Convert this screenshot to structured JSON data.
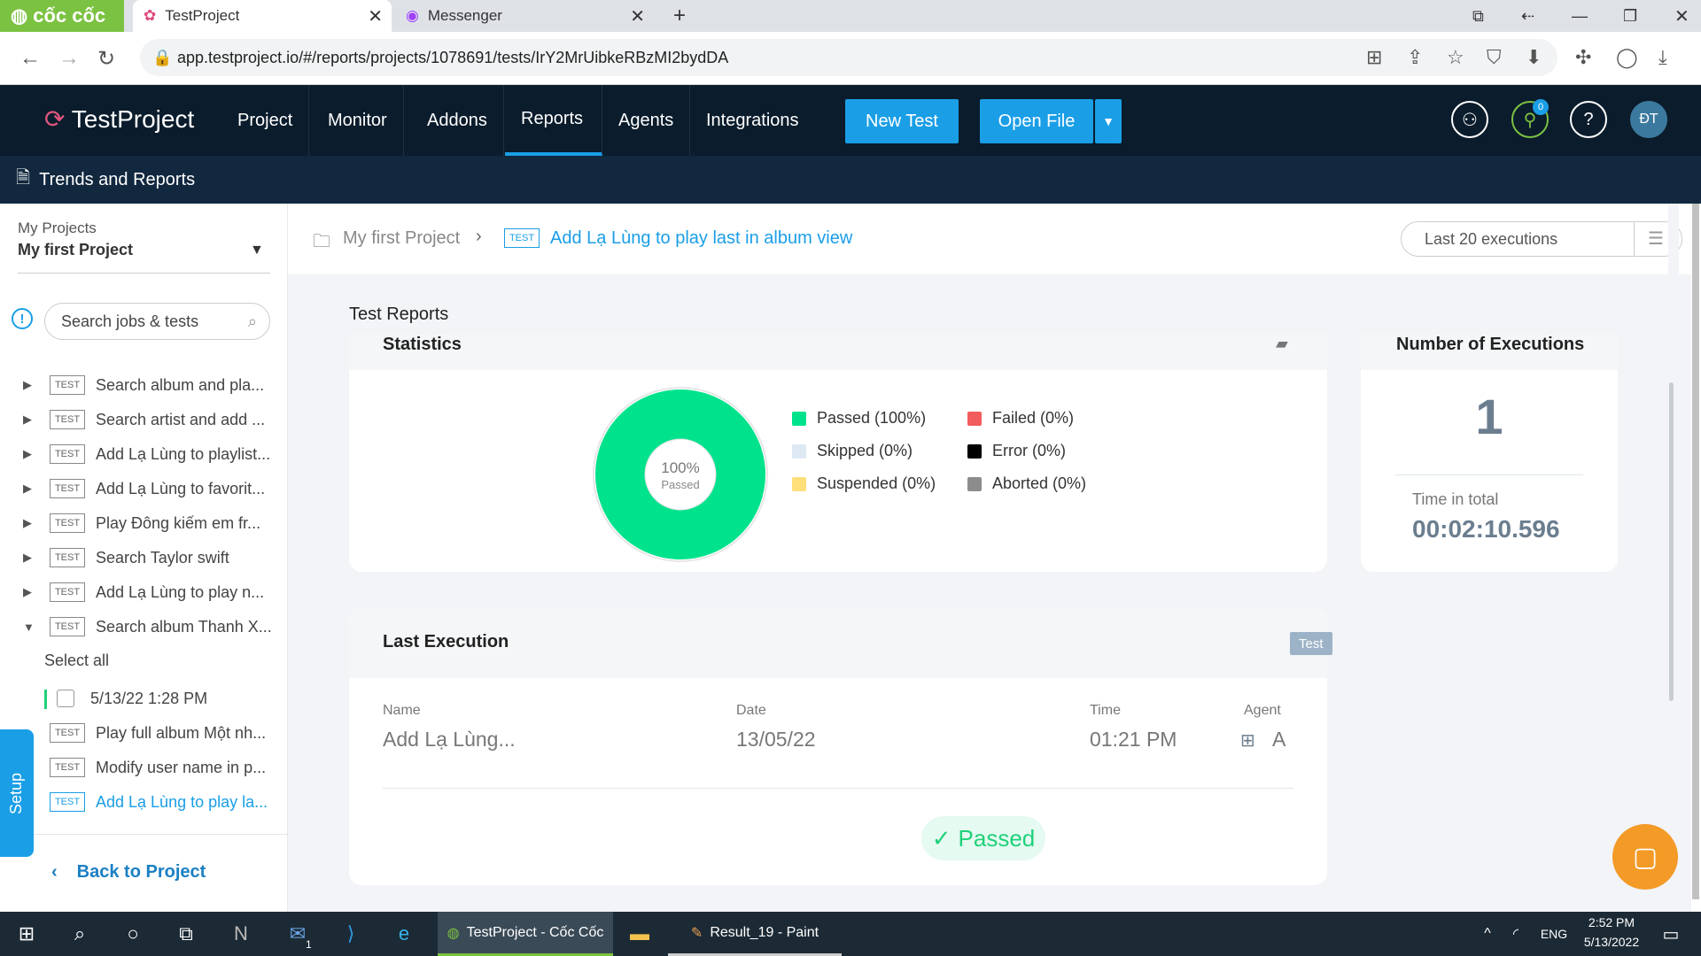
{
  "browser": {
    "brand": "cốc cốc",
    "tabs": [
      {
        "title": "TestProject"
      },
      {
        "title": "Messenger"
      }
    ],
    "url": "app.testproject.io/#/reports/projects/1078691/tests/IrY2MrUibkeRBzMI2bydDA"
  },
  "app": {
    "logo": "TestProject",
    "nav": [
      "Project",
      "Monitor",
      "Addons",
      "Reports",
      "Agents",
      "Integrations"
    ],
    "selected_nav": "Reports",
    "new_test": "New Test",
    "open_file": "Open File",
    "avatar": "ĐT",
    "notification_count": "0",
    "subheader": "Trends and Reports"
  },
  "sidebar": {
    "projects_label": "My Projects",
    "project_name": "My first Project",
    "search_placeholder": "Search jobs & tests",
    "items": [
      {
        "badge": "TEST",
        "label": "Search album and pla..."
      },
      {
        "badge": "TEST",
        "label": "Search artist and add ..."
      },
      {
        "badge": "TEST",
        "label": "Add Lạ Lùng to playlist..."
      },
      {
        "badge": "TEST",
        "label": "Add Lạ Lùng to favorit..."
      },
      {
        "badge": "TEST",
        "label": "Play Đông kiếm em fr..."
      },
      {
        "badge": "TEST",
        "label": "Search Taylor swift"
      },
      {
        "badge": "TEST",
        "label": "Add Lạ Lùng to play n..."
      },
      {
        "badge": "TEST",
        "label": "Search album Thanh X..."
      }
    ],
    "select_all": "Select all",
    "execution": "5/13/22 1:28 PM",
    "items2": [
      {
        "badge": "TEST",
        "label": "Play full album Một nh..."
      },
      {
        "badge": "TEST",
        "label": "Modify user name in p..."
      },
      {
        "badge": "TEST",
        "label": "Add Lạ Lùng to play la..."
      }
    ],
    "back": "Back to Project",
    "setup": "Setup"
  },
  "breadcrumb": {
    "project": "My first Project",
    "badge": "TEST",
    "test": "Add Lạ Lùng to play last in album view"
  },
  "filter": {
    "value": "Last 20 executions"
  },
  "reports": {
    "title": "Test Reports",
    "statistics": "Statistics",
    "center_pct": "100%",
    "center_lbl": "Passed",
    "legend": [
      {
        "label": "Passed (100%)",
        "color": "#00e38c"
      },
      {
        "label": "Skipped (0%)",
        "color": "#dde8f3"
      },
      {
        "label": "Suspended (0%)",
        "color": "#ffdf7a"
      },
      {
        "label": "Failed (0%)",
        "color": "#f25c5c"
      },
      {
        "label": "Error (0%)",
        "color": "#000000"
      },
      {
        "label": "Aborted (0%)",
        "color": "#8c8c8c"
      }
    ],
    "executions_title": "Number of Executions",
    "executions_count": "1",
    "time_label": "Time in total",
    "time_value": "00:02:10.596"
  },
  "chart_data": {
    "type": "pie",
    "categories": [
      "Passed",
      "Skipped",
      "Suspended",
      "Failed",
      "Error",
      "Aborted"
    ],
    "values": [
      100,
      0,
      0,
      0,
      0,
      0
    ]
  },
  "last_execution": {
    "title": "Last Execution",
    "badge": "Test",
    "name_label": "Name",
    "name": "Add Lạ Lùng...",
    "date_label": "Date",
    "date": "13/05/22",
    "time_label": "Time",
    "time": "01:21 PM",
    "agent_label": "Agent",
    "agent": "A",
    "status": "Passed"
  },
  "taskbar": {
    "app1": "TestProject - Cốc Cốc",
    "app2": "Result_19 - Paint",
    "lang": "ENG",
    "clock_time": "2:52 PM",
    "clock_date": "5/13/2022",
    "mail_count": "1"
  }
}
